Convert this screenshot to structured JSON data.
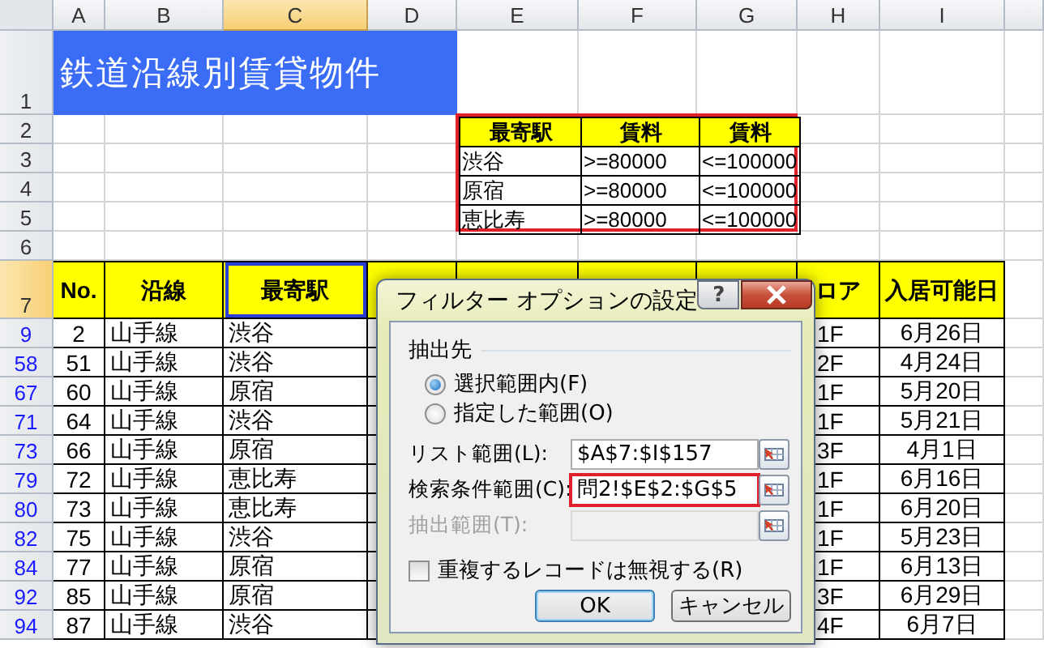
{
  "column_headers": [
    {
      "label": "A",
      "selected": false
    },
    {
      "label": "B",
      "selected": false
    },
    {
      "label": "C",
      "selected": true
    },
    {
      "label": "D",
      "selected": false
    },
    {
      "label": "E",
      "selected": false
    },
    {
      "label": "F",
      "selected": false
    },
    {
      "label": "G",
      "selected": false
    },
    {
      "label": "H",
      "selected": false
    },
    {
      "label": "I",
      "selected": false
    }
  ],
  "row_headers": [
    {
      "label": "1",
      "selected": false,
      "filtered": false
    },
    {
      "label": "2",
      "selected": false,
      "filtered": false
    },
    {
      "label": "3",
      "selected": false,
      "filtered": false
    },
    {
      "label": "4",
      "selected": false,
      "filtered": false
    },
    {
      "label": "5",
      "selected": false,
      "filtered": false
    },
    {
      "label": "6",
      "selected": false,
      "filtered": false
    },
    {
      "label": "7",
      "selected": true,
      "filtered": false
    },
    {
      "label": "9",
      "selected": false,
      "filtered": true
    },
    {
      "label": "58",
      "selected": false,
      "filtered": true
    },
    {
      "label": "67",
      "selected": false,
      "filtered": true
    },
    {
      "label": "71",
      "selected": false,
      "filtered": true
    },
    {
      "label": "73",
      "selected": false,
      "filtered": true
    },
    {
      "label": "79",
      "selected": false,
      "filtered": true
    },
    {
      "label": "80",
      "selected": false,
      "filtered": true
    },
    {
      "label": "82",
      "selected": false,
      "filtered": true
    },
    {
      "label": "84",
      "selected": false,
      "filtered": true
    },
    {
      "label": "92",
      "selected": false,
      "filtered": true
    },
    {
      "label": "94",
      "selected": false,
      "filtered": true
    }
  ],
  "title": "鉄道沿線別賃貸物件",
  "criteria": {
    "columns": [
      "最寄駅",
      "賃料",
      "賃料"
    ],
    "rows": [
      [
        "渋谷",
        ">=80000",
        "<=100000"
      ],
      [
        "原宿",
        ">=80000",
        "<=100000"
      ],
      [
        "恵比寿",
        ">=80000",
        "<=100000"
      ]
    ]
  },
  "table": {
    "columns": [
      {
        "kind": "text",
        "label": "No.",
        "selected": false
      },
      {
        "kind": "text",
        "label": "沿線",
        "selected": false
      },
      {
        "kind": "text",
        "label": "最寄駅",
        "selected": true
      },
      {
        "kind": "blank",
        "selected": false
      },
      {
        "kind": "blank",
        "selected": false
      },
      {
        "kind": "blank",
        "selected": false
      },
      {
        "kind": "blank",
        "selected": false
      },
      {
        "kind": "text",
        "label": "ロア",
        "selected": false
      },
      {
        "kind": "text",
        "label": "入居可能日",
        "selected": false
      }
    ],
    "rows": [
      {
        "no": "2",
        "line": "山手線",
        "station": "渋谷",
        "floor": "1F",
        "move_in": "6月26日"
      },
      {
        "no": "51",
        "line": "山手線",
        "station": "渋谷",
        "floor": "2F",
        "move_in": "4月24日"
      },
      {
        "no": "60",
        "line": "山手線",
        "station": "原宿",
        "floor": "1F",
        "move_in": "5月20日"
      },
      {
        "no": "64",
        "line": "山手線",
        "station": "渋谷",
        "floor": "1F",
        "move_in": "5月21日"
      },
      {
        "no": "66",
        "line": "山手線",
        "station": "原宿",
        "floor": "3F",
        "move_in": "4月1日"
      },
      {
        "no": "72",
        "line": "山手線",
        "station": "恵比寿",
        "floor": "1F",
        "move_in": "6月16日"
      },
      {
        "no": "73",
        "line": "山手線",
        "station": "恵比寿",
        "floor": "1F",
        "move_in": "6月20日"
      },
      {
        "no": "75",
        "line": "山手線",
        "station": "渋谷",
        "floor": "1F",
        "move_in": "5月23日"
      },
      {
        "no": "77",
        "line": "山手線",
        "station": "原宿",
        "floor": "1F",
        "move_in": "6月13日"
      },
      {
        "no": "85",
        "line": "山手線",
        "station": "原宿",
        "floor": "3F",
        "move_in": "6月29日"
      },
      {
        "no": "87",
        "line": "山手線",
        "station": "渋谷",
        "floor": "4F",
        "move_in": "6月7日"
      }
    ]
  },
  "dialog": {
    "title": "フィルター オプションの設定",
    "help": "?",
    "group": "抽出先",
    "options": [
      {
        "label": "選択範囲内(F)",
        "selected": true
      },
      {
        "label": "指定した範囲(O)",
        "selected": false
      }
    ],
    "fields": [
      {
        "label": "リスト範囲(L):",
        "value": "$A$7:$I$157",
        "disabled": false,
        "highlighted": false
      },
      {
        "label": "検索条件範囲(C):",
        "value": "問2!$E$2:$G$5",
        "disabled": false,
        "highlighted": true
      },
      {
        "label": "抽出範囲(T):",
        "disabled": true,
        "highlighted": false
      }
    ],
    "checkbox": {
      "label": "重複するレコードは無視する(R)",
      "checked": false
    },
    "buttons": [
      {
        "label": "OK",
        "default": true
      },
      {
        "label": "キャンセル",
        "default": false
      }
    ]
  }
}
